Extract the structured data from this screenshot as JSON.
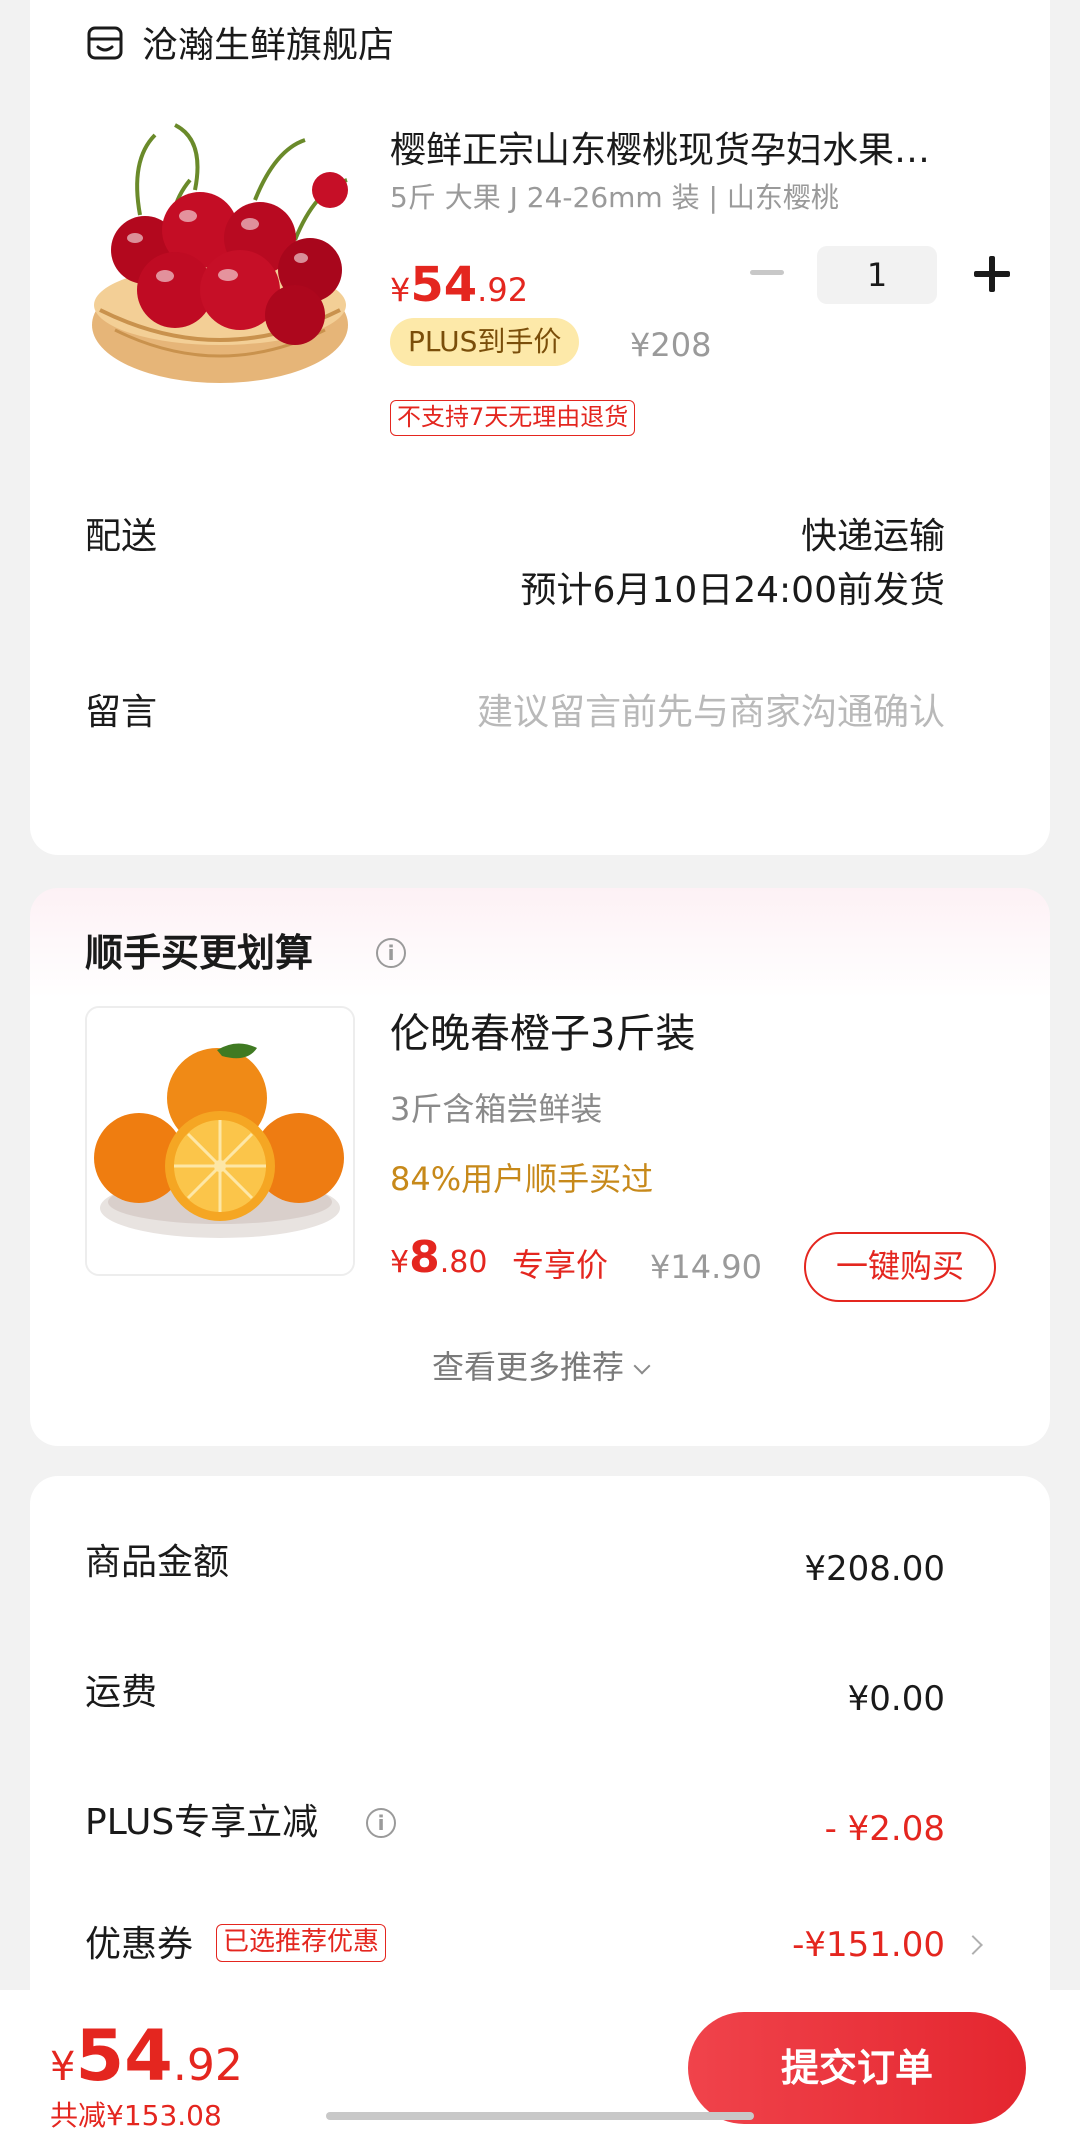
{
  "store": {
    "name": "沧瀚生鲜旗舰店",
    "icon": "store-icon"
  },
  "product": {
    "title": "樱鲜正宗山东樱桃现货孕妇水果…",
    "spec": "5斤 大果 J 24-26mm 装 | 山东樱桃",
    "price_yen": "¥",
    "price_int": "54",
    "price_dec": ".92",
    "quantity": "1",
    "plus_badge": "PLUS到手价",
    "original_price": "¥208",
    "return_notice": "不支持7天无理由退货"
  },
  "shipping": {
    "label": "配送",
    "method": "快递运输",
    "estimate": "预计6月10日24:00前发货"
  },
  "message": {
    "label": "留言",
    "placeholder": "建议留言前先与商家沟通确认"
  },
  "recommend": {
    "title": "顺手买更划算",
    "item_name": "伦晚春橙子3斤装",
    "item_spec": "3斤含箱尝鲜装",
    "item_bought": "84%用户顺手买过",
    "price_yen": "¥",
    "price_int": "8",
    "price_dec": ".80",
    "price_tag": "专享价",
    "original_price": "¥14.90",
    "buy_label": "一键购买",
    "more_label": "查看更多推荐"
  },
  "summary": {
    "goods_label": "商品金额",
    "goods_value": "¥208.00",
    "shipping_label": "运费",
    "shipping_value": "¥0.00",
    "plus_label": "PLUS专享立减",
    "plus_value": "- ¥2.08",
    "coupon_label": "优惠券",
    "coupon_tag": "已选推荐优惠",
    "coupon_value": "-¥151.00"
  },
  "footer": {
    "total_yen": "¥",
    "total_int": "54",
    "total_dec": ".92",
    "saved": "共减¥153.08",
    "submit_label": "提交订单"
  },
  "colors": {
    "accent_red": "#e4261f",
    "plus_gold": "#fde9a9",
    "bought_orange": "#c7891a"
  }
}
